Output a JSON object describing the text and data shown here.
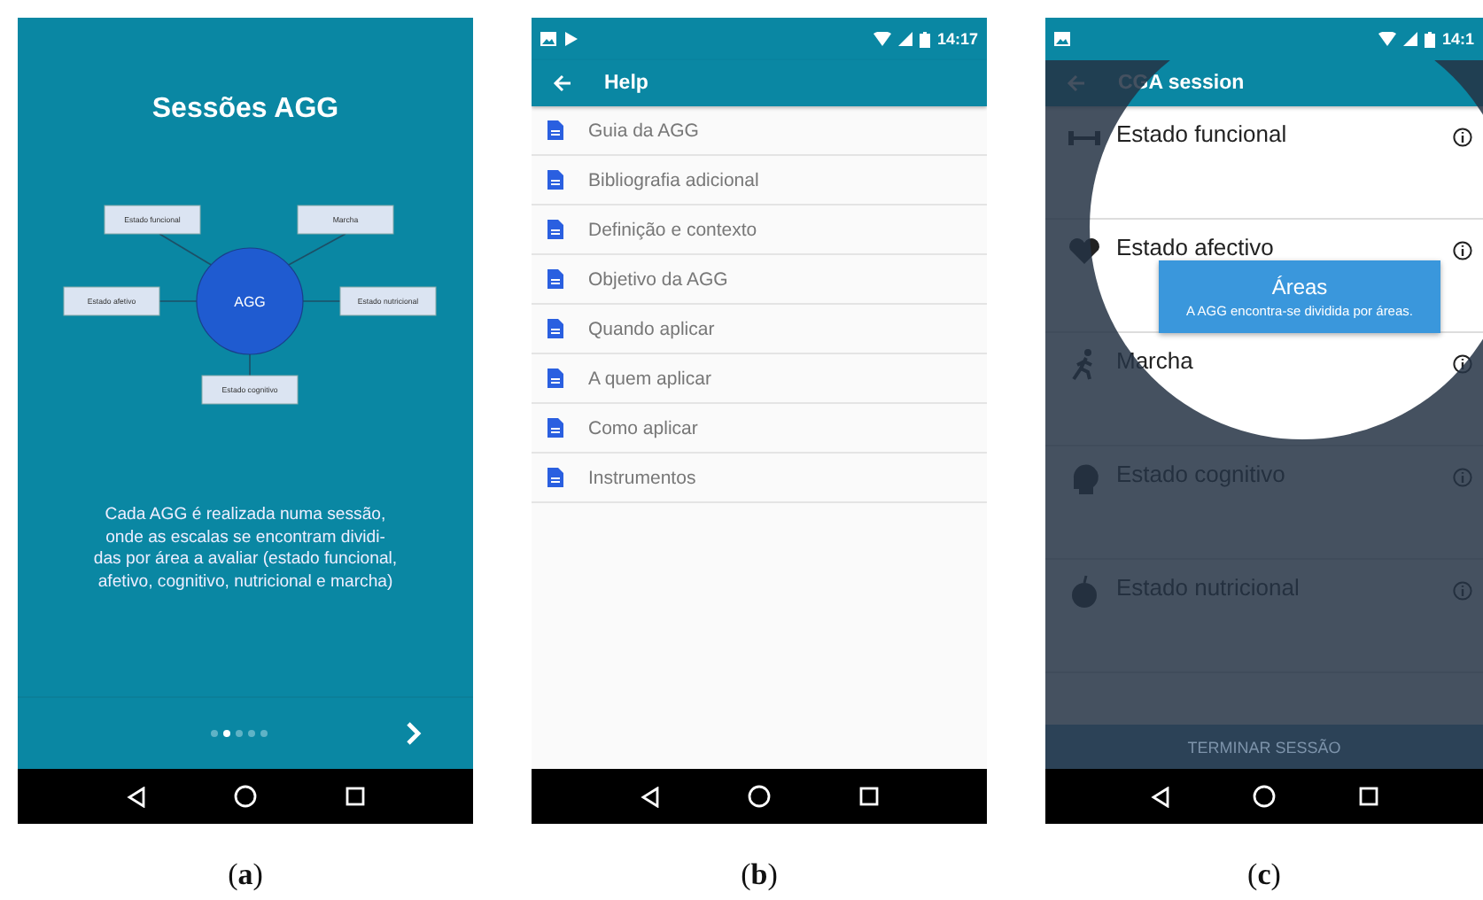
{
  "intro_screen": {
    "title": "Sessões AGG",
    "diagram": {
      "center": "AGG",
      "nodes": [
        {
          "label": "Estado funcional"
        },
        {
          "label": "Marcha"
        },
        {
          "label": "Estado afetivo"
        },
        {
          "label": "Estado nutricional"
        },
        {
          "label": "Estado cognitivo"
        }
      ]
    },
    "description": [
      "Cada AGG é realizada numa sessão,",
      "onde as escalas se encontram dividi-",
      "das por área a avaliar (estado funcional,",
      "afetivo, cognitivo, nutricional e marcha)"
    ],
    "pager": [
      {
        "selected": false
      },
      {
        "selected": true
      },
      {
        "selected": false
      },
      {
        "selected": false
      },
      {
        "selected": false
      }
    ],
    "caption": "(**a**)"
  },
  "help_screen": {
    "status_bar": {
      "time": "14:17"
    },
    "toolbar": {
      "title": "Help"
    },
    "items": [
      {
        "label": "Guia da AGG"
      },
      {
        "label": "Bibliografia adicional"
      },
      {
        "label": "Definição e contexto"
      },
      {
        "label": "Objetivo da AGG"
      },
      {
        "label": "Quando aplicar"
      },
      {
        "label": "A quem aplicar"
      },
      {
        "label": "Como aplicar"
      },
      {
        "label": "Instrumentos"
      }
    ],
    "caption": "(**b**)"
  },
  "session_screen": {
    "status_bar": {
      "time": "14:1"
    },
    "toolbar": {
      "title": "CGA session"
    },
    "areas": [
      {
        "label": "Estado funcional",
        "kind": "functional"
      },
      {
        "label": "Estado afectivo",
        "kind": "affective"
      },
      {
        "label": "Marcha",
        "kind": "gait"
      },
      {
        "label": "Estado cognitivo",
        "kind": "cognitive"
      },
      {
        "label": "Estado nutricional",
        "kind": "nutritional"
      }
    ],
    "tooltip": {
      "title": "Áreas",
      "text": "A AGG encontra-se dividida por áreas."
    },
    "button": "TERMINAR SESSÃO",
    "caption": "(**c**)"
  }
}
